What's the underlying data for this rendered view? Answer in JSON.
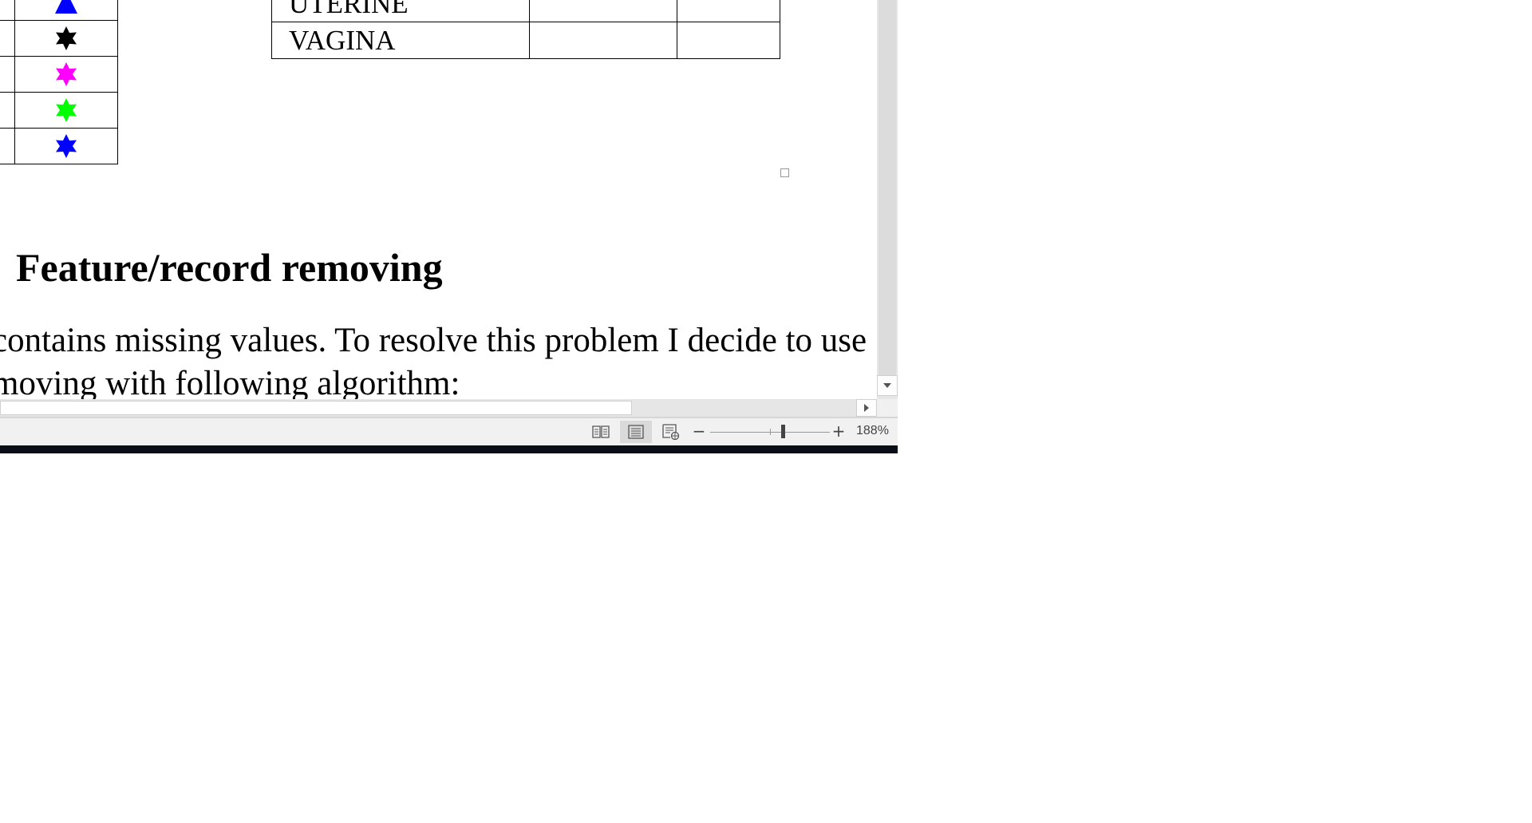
{
  "document": {
    "symbol_rows": [
      {
        "shape": "triangle",
        "color": "#0000ff"
      },
      {
        "shape": "star",
        "color": "#000000"
      },
      {
        "shape": "star",
        "color": "#ff00ff"
      },
      {
        "shape": "star",
        "color": "#00ff00"
      },
      {
        "shape": "star",
        "color": "#0000ff"
      }
    ],
    "class_rows": [
      "UTERINE",
      "VAGINA"
    ],
    "heading": "Feature/record removing",
    "paragraph_lines": [
      "contains missing values. To resolve this problem I decide to use",
      "moving with following algorithm:"
    ]
  },
  "statusbar": {
    "views": [
      {
        "name": "read-mode-icon"
      },
      {
        "name": "print-layout-icon",
        "active": true
      },
      {
        "name": "web-layout-icon"
      }
    ],
    "zoom_minus": "−",
    "zoom_plus": "+",
    "zoom_level": "188%",
    "zoom_percent": 188
  },
  "colors": {
    "statusbar_bg": "#f1f1f1",
    "scrollbar_bg": "#e6e6e6",
    "taskbar": "#0a0e17"
  }
}
